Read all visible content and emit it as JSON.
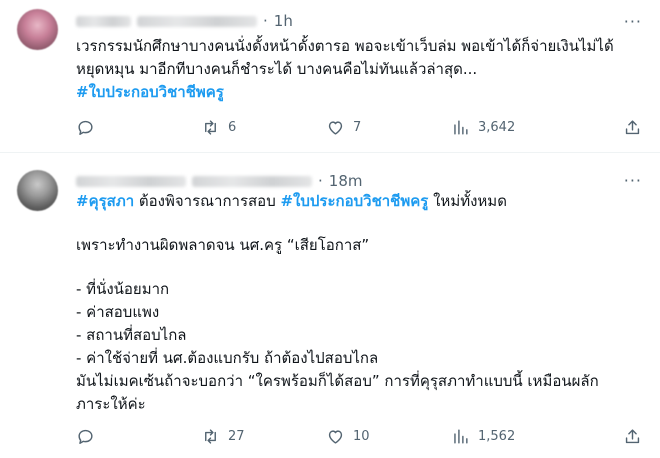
{
  "tweets": [
    {
      "time": "1h",
      "lines": [
        "เวรกรรมนักศึกษาบางคนนั่งดั้งหน้าดั้งตารอ พอจะเข้าเว็บล่ม พอเข้าได้ก็จ่ายเงินไม่ได้",
        "หยุดหมุน มาอีกทีบางคนก็ชำระได้ บางคนคือไม่ทันแล้วล่าสุด..."
      ],
      "hashtag_line": "#ใบประกอบวิชาชีพครู",
      "replies": "",
      "retweets": "6",
      "likes": "7",
      "views": "3,642"
    },
    {
      "time": "18m",
      "first_line": {
        "tag1": "#คุรุสภา",
        "mid": " ต้องพิจารณาการสอบ ",
        "tag2": "#ใบประกอบวิชาชีพครู",
        "end": " ใหม่ทั้งหมด"
      },
      "line_2": "เพราะทำงานผิดพลาดจน นศ.ครู “เสียโอกาส”",
      "bullets": [
        "- ที่นั่งน้อยมาก",
        "- ค่าสอบแพง",
        "- สถานที่สอบไกล",
        "- ค่าใช้จ่ายที่ นศ.ต้องแบกรับ ถ้าต้องไปสอบไกล"
      ],
      "closing": [
        "มันไม่เมคเซ้นถ้าจะบอกว่า “ใครพร้อมก็ได้สอบ” การที่คุรุสภาทำแบบนี้ เหมือนผลัก",
        "ภาระให้ค่ะ"
      ],
      "replies": "",
      "retweets": "27",
      "likes": "10",
      "views": "1,562"
    }
  ],
  "icons": {
    "reply": "speech-bubble-icon",
    "retweet": "retweet-icon",
    "like": "heart-icon",
    "views": "bar-chart-icon",
    "share": "share-upload-icon",
    "more": "more-dots-icon"
  },
  "colors": {
    "hashtag": "#1d9bf0",
    "text": "#0f1419",
    "muted": "#536471"
  },
  "labels": {
    "dot": "·",
    "more": "···"
  }
}
